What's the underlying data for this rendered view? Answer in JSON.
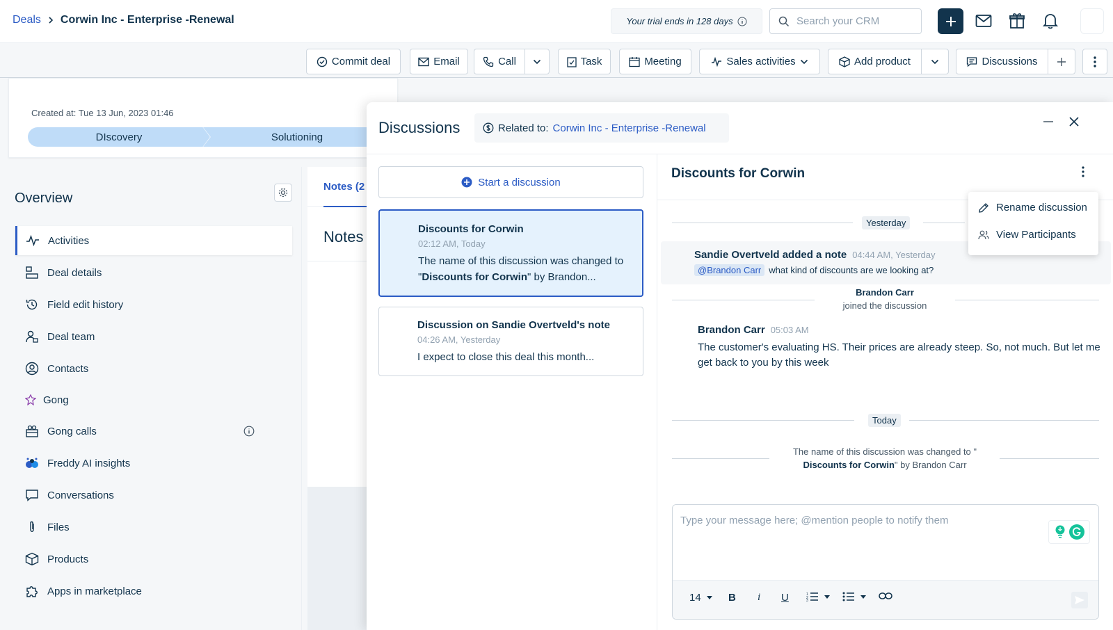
{
  "breadcrumb": {
    "parent": "Deals",
    "current": "Corwin Inc - Enterprise -Renewal"
  },
  "header": {
    "trial_text": "Your trial ends in 128 days",
    "search_placeholder": "Search your CRM"
  },
  "toolbar": {
    "commit": "Commit deal",
    "email": "Email",
    "call": "Call",
    "task": "Task",
    "meeting": "Meeting",
    "sales": "Sales activities",
    "add_product": "Add product",
    "discussions": "Discussions"
  },
  "deal": {
    "created": "Created at: Tue 13 Jun, 2023 01:46",
    "stages": [
      "DIscovery",
      "Solutioning"
    ]
  },
  "overview": {
    "title": "Overview",
    "items": [
      {
        "label": "Activities",
        "icon": "pulse-icon"
      },
      {
        "label": "Deal details",
        "icon": "details-icon"
      },
      {
        "label": "Field edit history",
        "icon": "history-icon"
      },
      {
        "label": "Deal team",
        "icon": "team-icon"
      },
      {
        "label": "Contacts",
        "icon": "contact-icon"
      },
      {
        "label": "Gong",
        "icon": "gong-icon"
      },
      {
        "label": "Gong calls",
        "icon": "gong-calls-icon"
      },
      {
        "label": "Freddy AI insights",
        "icon": "freddy-icon"
      },
      {
        "label": "Conversations",
        "icon": "chat-icon"
      },
      {
        "label": "Files",
        "icon": "paperclip-icon"
      },
      {
        "label": "Products",
        "icon": "box-icon"
      },
      {
        "label": "Apps in marketplace",
        "icon": "puzzle-icon"
      }
    ]
  },
  "notes": {
    "tab": "Notes (2",
    "heading": "Notes"
  },
  "modal": {
    "title": "Discussions",
    "related_label": "Related to:",
    "related_link": "Corwin Inc - Enterprise -Renewal",
    "start_label": "Start a discussion",
    "list": [
      {
        "title": "Discounts for Corwin",
        "time": "02:12 AM, Today",
        "preview_a": "The name of this discussion was changed",
        "preview_b": "to \"",
        "preview_bold": "Discounts for Corwin",
        "preview_c": "\" by Brandon..."
      },
      {
        "title": "Discussion on Sandie Overtveld's note",
        "time": "04:26 AM, Yesterday",
        "preview": "I expect to close this deal this month..."
      }
    ],
    "thread": {
      "title": "Discounts for Corwin",
      "day1": "Yesterday",
      "msg1_author": "Sandie Overtveld added a note",
      "msg1_time": "04:44 AM, Yesterday",
      "msg1_mention": "@Brandon Carr",
      "msg1_text": "what kind of discounts are we looking at?",
      "joined_name": "Brandon Carr",
      "joined_text": "joined the discussion",
      "msg2_author": "Brandon Carr",
      "msg2_time": "05:03 AM",
      "msg2_text": "The customer's evaluating HS. Their prices are already steep. So, not much. But let me get back to you by this week",
      "day2": "Today",
      "renamed_a": "The name of this discussion was changed to \"",
      "renamed_bold": "Discounts for Corwin",
      "renamed_b": "\" by Brandon Carr",
      "composer_placeholder": "Type your message here; @mention people to notify them",
      "font_size": "14"
    },
    "menu": {
      "rename": "Rename discussion",
      "participants": "View Participants"
    }
  },
  "colors": {
    "accent": "#2c5cc5",
    "primary_dark": "#12344d",
    "stage_fill": "#bfdcf8",
    "selected_card": "#e5f2fd"
  }
}
